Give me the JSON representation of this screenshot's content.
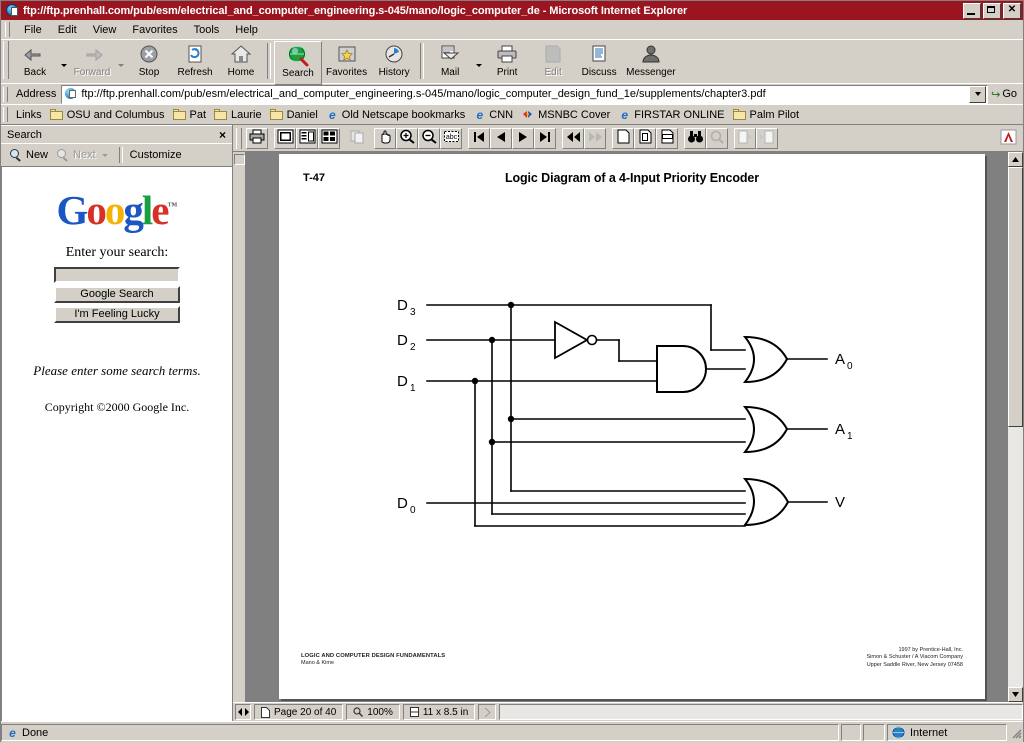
{
  "window": {
    "title": "ftp://ftp.prenhall.com/pub/esm/electrical_and_computer_engineering.s-045/mano/logic_computer_de - Microsoft Internet Explorer",
    "minimize_label": "Minimize",
    "maximize_label": "Maximize",
    "close_label": "Close"
  },
  "menubar": {
    "items": [
      {
        "label": "File"
      },
      {
        "label": "Edit"
      },
      {
        "label": "View"
      },
      {
        "label": "Favorites"
      },
      {
        "label": "Tools"
      },
      {
        "label": "Help"
      }
    ]
  },
  "toolbar": {
    "buttons": [
      {
        "label": "Back",
        "icon": "back-arrow-icon",
        "disabled": false,
        "dropdown": true
      },
      {
        "label": "Forward",
        "icon": "forward-arrow-icon",
        "disabled": true,
        "dropdown": true
      },
      {
        "label": "Stop",
        "icon": "stop-icon",
        "disabled": false
      },
      {
        "label": "Refresh",
        "icon": "refresh-icon",
        "disabled": false
      },
      {
        "label": "Home",
        "icon": "home-icon",
        "disabled": false
      },
      {
        "label": "Search",
        "icon": "search-globe-icon",
        "disabled": false,
        "selected": true
      },
      {
        "label": "Favorites",
        "icon": "favorites-folder-icon",
        "disabled": false
      },
      {
        "label": "History",
        "icon": "history-clock-icon",
        "disabled": false
      },
      {
        "label": "Mail",
        "icon": "mail-icon",
        "disabled": false,
        "dropdown": true
      },
      {
        "label": "Print",
        "icon": "printer-icon",
        "disabled": false
      },
      {
        "label": "Edit",
        "icon": "edit-page-icon",
        "disabled": true
      },
      {
        "label": "Discuss",
        "icon": "discuss-icon",
        "disabled": false
      },
      {
        "label": "Messenger",
        "icon": "messenger-person-icon",
        "disabled": false
      }
    ]
  },
  "address": {
    "label": "Address",
    "value": "ftp://ftp.prenhall.com/pub/esm/electrical_and_computer_engineering.s-045/mano/logic_computer_design_fund_1e/supplements/chapter3.pdf",
    "placeholder": "",
    "go_label": "Go",
    "go_arrow": "↪"
  },
  "links": {
    "label": "Links",
    "items": [
      {
        "label": "OSU and Columbus",
        "icon": "folder-icon"
      },
      {
        "label": "Pat",
        "icon": "folder-icon"
      },
      {
        "label": "Laurie",
        "icon": "folder-icon"
      },
      {
        "label": "Daniel",
        "icon": "folder-icon"
      },
      {
        "label": "Old Netscape bookmarks",
        "icon": "ie-page-icon"
      },
      {
        "label": "CNN",
        "icon": "ie-page-icon"
      },
      {
        "label": "MSNBC Cover",
        "icon": "msn-butterfly-icon"
      },
      {
        "label": "FIRSTAR ONLINE",
        "icon": "ie-page-icon"
      },
      {
        "label": "Palm Pilot",
        "icon": "folder-icon"
      }
    ]
  },
  "search_pane": {
    "title": "Search",
    "close_label": "×",
    "tools": [
      {
        "label": "New",
        "icon": "new-search-icon",
        "disabled": false
      },
      {
        "label": "Next",
        "icon": "next-search-icon",
        "disabled": true
      },
      {
        "label": "Customize",
        "icon": "customize-icon",
        "disabled": false
      }
    ],
    "google": {
      "logo_letters": [
        "G",
        "o",
        "o",
        "g",
        "l",
        "e"
      ],
      "trademark": "™",
      "prompt": "Enter your search:",
      "input_value": "",
      "input_placeholder": "",
      "search_button": "Google Search",
      "lucky_button": "I'm Feeling Lucky",
      "message": "Please enter some search terms.",
      "copyright": "Copyright ©2000 Google Inc."
    }
  },
  "acrobat": {
    "toolbar_buttons": [
      {
        "name": "print",
        "icon": "printer-icon"
      },
      {
        "name": "page-only",
        "icon": "page-only-icon"
      },
      {
        "name": "bookmarks",
        "icon": "bookmarks-icon"
      },
      {
        "name": "thumbnails",
        "icon": "thumbnails-icon"
      },
      {
        "name": "copy",
        "icon": "copy-icon",
        "disabled": true
      },
      {
        "name": "hand-tool",
        "icon": "hand-icon"
      },
      {
        "name": "zoom-in",
        "icon": "zoom-in-icon"
      },
      {
        "name": "zoom-out",
        "icon": "zoom-out-icon"
      },
      {
        "name": "text-select",
        "icon": "abc-select-icon"
      },
      {
        "name": "first-page",
        "icon": "first-page-icon"
      },
      {
        "name": "previous-page",
        "icon": "previous-page-icon"
      },
      {
        "name": "next-page",
        "icon": "next-page-icon"
      },
      {
        "name": "last-page",
        "icon": "last-page-icon"
      },
      {
        "name": "go-back",
        "icon": "go-back-icon"
      },
      {
        "name": "go-forward",
        "icon": "go-forward-icon",
        "disabled": true
      },
      {
        "name": "actual-size",
        "icon": "actual-size-icon"
      },
      {
        "name": "fit-page",
        "icon": "fit-page-icon"
      },
      {
        "name": "fit-width",
        "icon": "fit-width-icon"
      },
      {
        "name": "find",
        "icon": "binoculars-icon"
      },
      {
        "name": "search",
        "icon": "search-index-icon",
        "disabled": true
      },
      {
        "name": "web-capture",
        "icon": "web-capture-icon",
        "disabled": true
      },
      {
        "name": "next-highlight",
        "icon": "next-highlight-icon",
        "disabled": true
      },
      {
        "name": "acrobat-logo",
        "icon": "acrobat-logo-icon"
      }
    ],
    "status": {
      "page_label": "Page 20 of 40",
      "zoom_label": "100%",
      "size_label": "11 x 8.5 in"
    }
  },
  "pdf_page": {
    "slide_number": "T-47",
    "title": "Logic Diagram of a 4-Input Priority Encoder",
    "inputs": [
      {
        "label": "D",
        "sub": "3"
      },
      {
        "label": "D",
        "sub": "2"
      },
      {
        "label": "D",
        "sub": "1"
      },
      {
        "label": "D",
        "sub": "0"
      }
    ],
    "outputs": [
      {
        "label": "A",
        "sub": "0"
      },
      {
        "label": "A",
        "sub": "1"
      },
      {
        "label": "V",
        "sub": ""
      }
    ],
    "gates": [
      {
        "type": "inverter",
        "name": "not-gate-d2"
      },
      {
        "type": "and",
        "name": "and-gate-d1-notd2"
      },
      {
        "type": "or",
        "name": "or-gate-a0",
        "inputs": 2
      },
      {
        "type": "or",
        "name": "or-gate-a1",
        "inputs": 2
      },
      {
        "type": "or",
        "name": "or-gate-v",
        "inputs": 4
      }
    ],
    "footer_left_line1": "LOGIC AND COMPUTER DESIGN FUNDAMENTALS",
    "footer_left_line2": "Mano & Kime",
    "footer_right_line1": "1997 by Prentice-Hall, Inc.",
    "footer_right_line2": "Simon & Schuster / A Viacom Company",
    "footer_right_line3": "Upper Saddle River, New Jersey 07458"
  },
  "statusbar": {
    "message": "Done",
    "zone": "Internet"
  },
  "colors": {
    "titlebar": "#9b1520",
    "chrome": "#d4d0c8",
    "page": "#ffffff",
    "stage": "#808080",
    "google_blue": "#1a56c4",
    "google_red": "#d93025",
    "google_yellow": "#f2b400",
    "google_green": "#1a9e3e"
  }
}
